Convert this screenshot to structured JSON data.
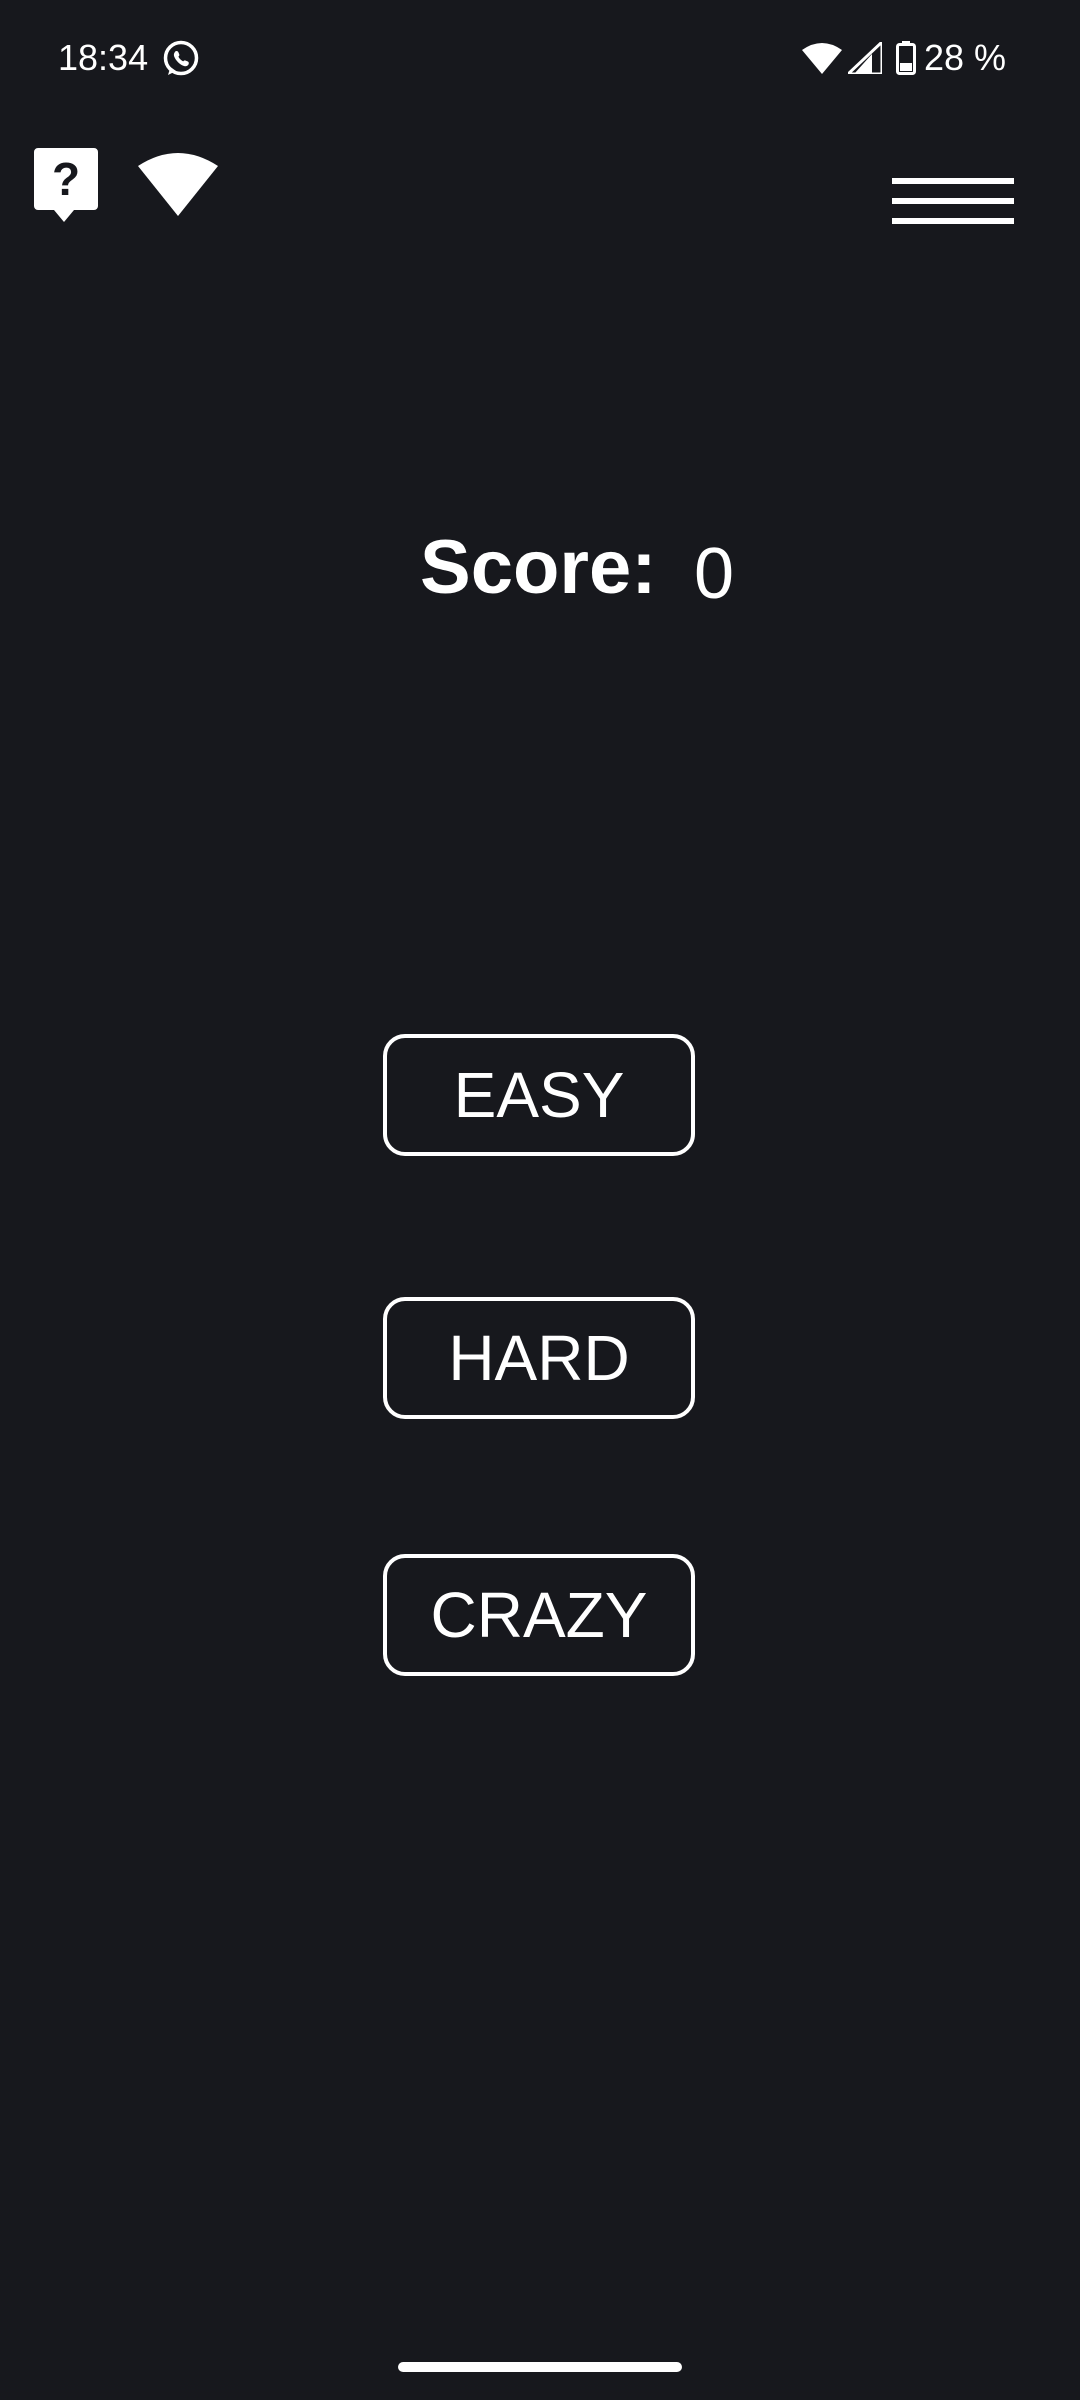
{
  "status_bar": {
    "time": "18:34",
    "battery": "28 %",
    "icons": [
      "whatsapp-icon",
      "wifi-icon",
      "cellular-signal-icon",
      "battery-icon"
    ]
  },
  "toolbar": {
    "help_icon": "question-bubble-icon",
    "connection_icon": "wifi-icon",
    "menu_icon": "hamburger-menu-icon"
  },
  "score": {
    "label": "Score:",
    "value": "0"
  },
  "difficulty": {
    "easy": "EASY",
    "hard": "HARD",
    "crazy": "CRAZY"
  },
  "colors": {
    "background": "#17181d",
    "foreground": "#ffffff"
  }
}
